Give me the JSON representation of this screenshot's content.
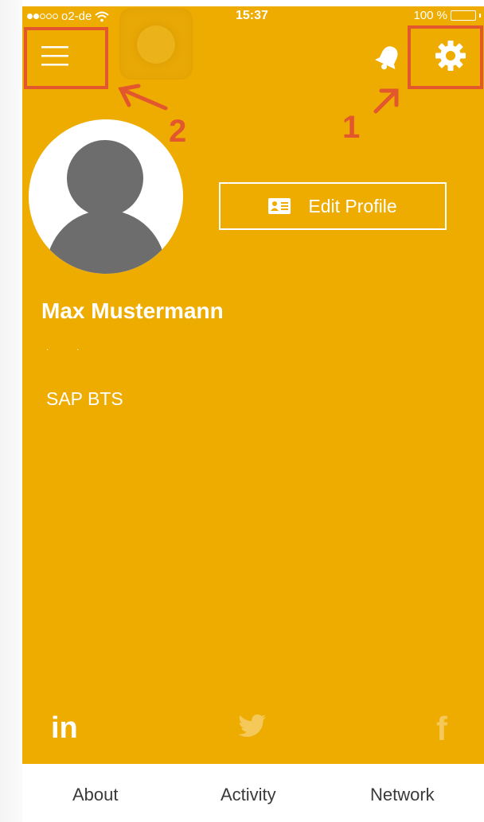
{
  "status_bar": {
    "carrier": "o2-de",
    "time": "15:37",
    "battery": "100 %"
  },
  "header": {
    "menu_icon": "hamburger-menu-icon",
    "notifications_icon": "bell-icon",
    "settings_icon": "gear-icon"
  },
  "annotations": {
    "label_1": "1",
    "label_2": "2",
    "color": "#E2572D"
  },
  "profile": {
    "edit_button_label": "Edit Profile",
    "edit_button_icon": "id-card-icon",
    "name": "Max Mustermann",
    "placeholder_line": "· ·",
    "company": "SAP BTS"
  },
  "social": {
    "linkedin": "in",
    "twitter_icon": "twitter-bird-icon",
    "facebook": "f"
  },
  "tabs": [
    {
      "label": "About"
    },
    {
      "label": "Activity"
    },
    {
      "label": "Network"
    }
  ],
  "colors": {
    "brand_yellow": "#EEAC00",
    "tab_text": "#3a3a3a"
  }
}
